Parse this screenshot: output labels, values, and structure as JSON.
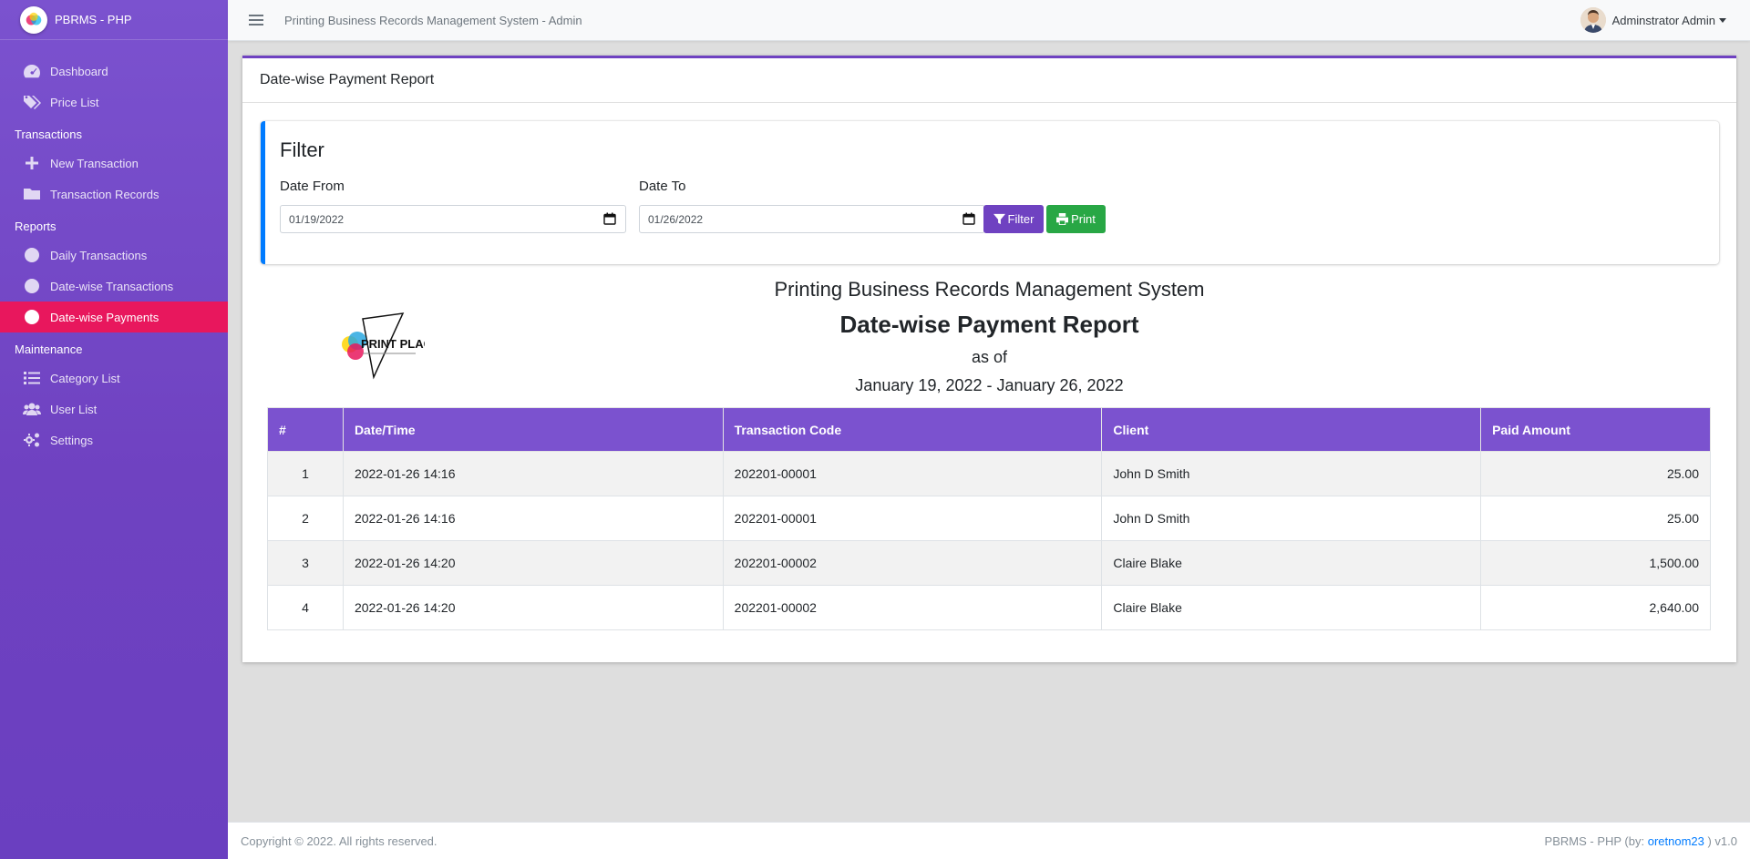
{
  "app": {
    "brand": "PBRMS - PHP",
    "top_title": "Printing Business Records Management System - Admin"
  },
  "user": {
    "name": "Adminstrator Admin"
  },
  "sidebar": {
    "items": [
      {
        "label": "Dashboard",
        "icon": "dashboard-icon"
      },
      {
        "label": "Price List",
        "icon": "tags-icon"
      },
      {
        "header": "Transactions"
      },
      {
        "label": "New Transaction",
        "icon": "plus-icon"
      },
      {
        "label": "Transaction Records",
        "icon": "folder-icon"
      },
      {
        "header": "Reports"
      },
      {
        "label": "Daily Transactions",
        "icon": "circle-icon"
      },
      {
        "label": "Date-wise Transactions",
        "icon": "circle-icon"
      },
      {
        "label": "Date-wise Payments",
        "icon": "circle-icon",
        "active": true
      },
      {
        "header": "Maintenance"
      },
      {
        "label": "Category List",
        "icon": "list-icon"
      },
      {
        "label": "User List",
        "icon": "users-icon"
      },
      {
        "label": "Settings",
        "icon": "cogs-icon"
      }
    ]
  },
  "page": {
    "title": "Date-wise Payment Report"
  },
  "filter": {
    "title": "Filter",
    "date_from_label": "Date From",
    "date_from_value": "01/19/2022",
    "date_to_label": "Date To",
    "date_to_value": "01/26/2022",
    "filter_button": "Filter",
    "print_button": "Print"
  },
  "report": {
    "system_name": "Printing Business Records Management System",
    "title": "Date-wise Payment Report",
    "as_of": "as of",
    "range": "January 19, 2022 - January 26, 2022",
    "logo_text": "PRINT PLACE"
  },
  "table": {
    "headers": [
      "#",
      "Date/Time",
      "Transaction Code",
      "Client",
      "Paid Amount"
    ],
    "rows": [
      {
        "num": "1",
        "datetime": "2022-01-26 14:16",
        "code": "202201-00001",
        "client": "John D Smith",
        "amount": "25.00"
      },
      {
        "num": "2",
        "datetime": "2022-01-26 14:16",
        "code": "202201-00001",
        "client": "John D Smith",
        "amount": "25.00"
      },
      {
        "num": "3",
        "datetime": "2022-01-26 14:20",
        "code": "202201-00002",
        "client": "Claire Blake",
        "amount": "1,500.00"
      },
      {
        "num": "4",
        "datetime": "2022-01-26 14:20",
        "code": "202201-00002",
        "client": "Claire Blake",
        "amount": "2,640.00"
      }
    ]
  },
  "footer": {
    "copyright": "Copyright © 2022. All rights reserved.",
    "credit_prefix": "PBRMS - PHP (by: ",
    "credit_link": "oretnom23",
    "credit_suffix": " ) v1.0"
  },
  "colors": {
    "primary": "#6f42c1",
    "active": "#e8175d",
    "filter_border": "#007bff",
    "success": "#28a745"
  }
}
